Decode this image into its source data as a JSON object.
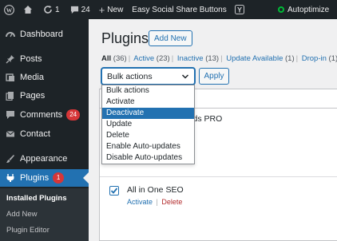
{
  "adminbar": {
    "updates_count": "1",
    "comments_count": "24",
    "new_label": "New",
    "plugin_link": "Easy Social Share Buttons",
    "autoptimize_label": "Autoptimize"
  },
  "sidebar": {
    "items": [
      {
        "label": "Dashboard",
        "icon": "dashboard-icon"
      },
      {
        "label": "Posts",
        "icon": "pin-icon"
      },
      {
        "label": "Media",
        "icon": "media-icon"
      },
      {
        "label": "Pages",
        "icon": "pages-icon"
      },
      {
        "label": "Comments",
        "icon": "comment-icon",
        "badge": "24"
      },
      {
        "label": "Contact",
        "icon": "mail-icon"
      },
      {
        "label": "Appearance",
        "icon": "brush-icon"
      },
      {
        "label": "Plugins",
        "icon": "plugin-icon",
        "badge": "1"
      }
    ],
    "submenu": [
      "Installed Plugins",
      "Add New",
      "Plugin Editor"
    ]
  },
  "main": {
    "title": "Plugins",
    "add_new": "Add New",
    "filters": [
      {
        "label": "All",
        "count": "(36)"
      },
      {
        "label": "Active",
        "count": "(23)"
      },
      {
        "label": "Inactive",
        "count": "(13)"
      },
      {
        "label": "Update Available",
        "count": "(1)"
      },
      {
        "label": "Drop-in",
        "count": "(1)"
      }
    ],
    "bulk_select": "Bulk actions",
    "apply": "Apply",
    "dropdown_options": [
      "Bulk actions",
      "Activate",
      "Deactivate",
      "Update",
      "Delete",
      "Enable Auto-updates",
      "Disable Auto-updates"
    ],
    "selected_option": "Deactivate",
    "row1_name_partial": "ields PRO",
    "plugin_name": "All in One SEO",
    "action_activate": "Activate",
    "action_sep": "|",
    "action_delete": "Delete"
  },
  "colors": {
    "accent": "#2271b1",
    "sidebar_bg": "#1d2327",
    "badge": "#d63638",
    "status_ok": "#00ba37"
  }
}
